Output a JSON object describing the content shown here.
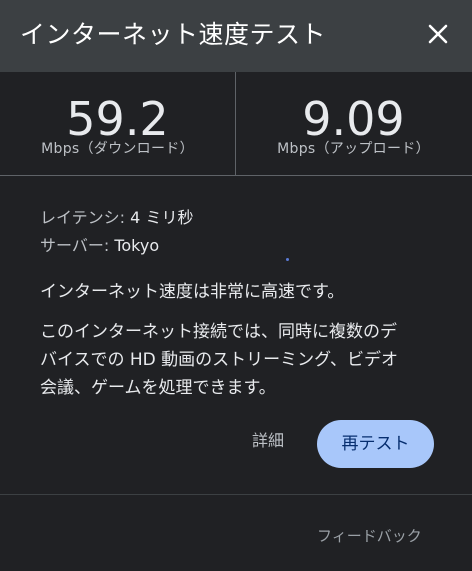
{
  "header": {
    "title": "インターネット速度テスト",
    "close_icon": "close-icon"
  },
  "results": {
    "download_value": "59.2",
    "download_unit": "Mbps（ダウンロード）",
    "upload_value": "9.09",
    "upload_unit": "Mbps（アップロード）"
  },
  "details": {
    "latency_label": "レイテンシ:",
    "latency_value": "4 ミリ秒",
    "server_label": "サーバー:",
    "server_value": "Tokyo"
  },
  "status": {
    "summary": "インターネット速度は非常に高速です。",
    "description_lines": [
      "このインターネット接続では、同時に複数のデ",
      "バイスでの HD 動画のストリーミング、ビデオ",
      "会議、ゲームを処理できます。"
    ]
  },
  "actions": {
    "details_label": "詳細",
    "retest_label": "再テスト"
  },
  "footer": {
    "feedback_label": "フィードバック"
  },
  "colors": {
    "background": "#202124",
    "header_bg": "#3c4043",
    "button_bg": "#a8c7fa",
    "button_text": "#062e6f"
  }
}
